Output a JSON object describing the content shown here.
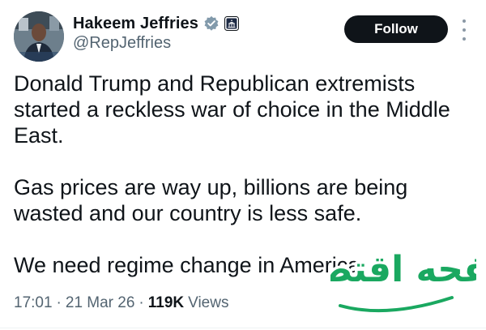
{
  "author": {
    "display_name": "Hakeem Jeffries",
    "handle": "@RepJeffries",
    "verified_icon": "verified-badge-icon",
    "affiliation_icon": "capitol-affiliation-icon"
  },
  "actions": {
    "follow_label": "Follow",
    "more_icon": "more-vertical-icon"
  },
  "tweet": {
    "paragraphs": [
      "Donald Trump and Republican extremists\nstarted a reckless war of choice in the Middle\nEast.",
      "Gas prices are way up, billions are being\nwasted and our country is less safe.",
      "We need regime change in America."
    ]
  },
  "meta": {
    "time": "17:01",
    "separator": "·",
    "date": "21 Mar 26",
    "views_count": "119K",
    "views_label": "Views"
  },
  "watermark": {
    "text": "صفحه اقتصاد"
  },
  "colors": {
    "follow_bg": "#0f1419",
    "verified": "#829aab",
    "secondary_text": "#536471",
    "watermark": "#1aa860"
  }
}
